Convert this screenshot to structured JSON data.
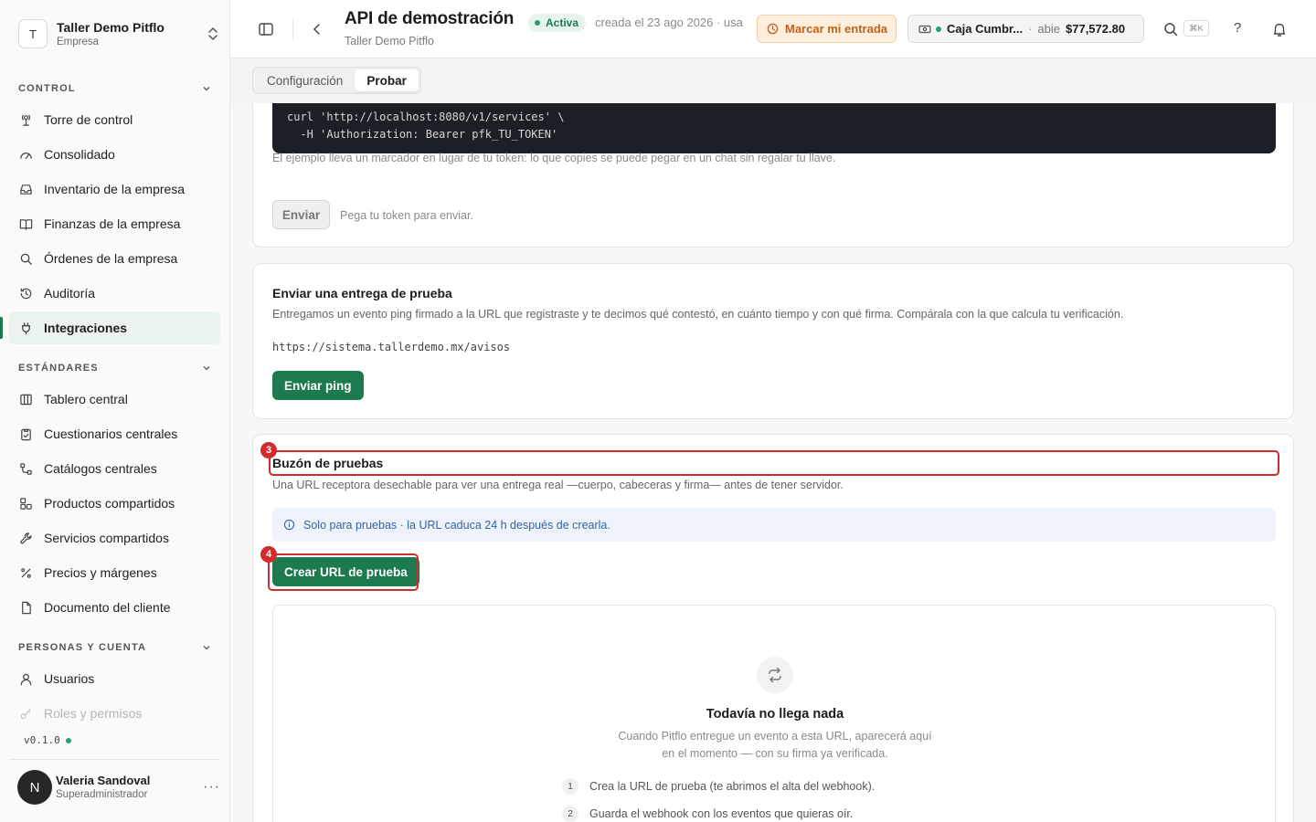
{
  "org": {
    "initial": "T",
    "name": "Taller Demo Pitflo",
    "type": "Empresa"
  },
  "sidebar": {
    "sections": [
      {
        "title": "CONTROL",
        "items": [
          "Torre de control",
          "Consolidado",
          "Inventario de la empresa",
          "Finanzas de la empresa",
          "Órdenes de la empresa",
          "Auditoría",
          "Integraciones"
        ]
      },
      {
        "title": "ESTÁNDARES",
        "items": [
          "Tablero central",
          "Cuestionarios centrales",
          "Catálogos centrales",
          "Productos compartidos",
          "Servicios compartidos",
          "Precios y márgenes",
          "Documento del cliente"
        ]
      },
      {
        "title": "PERSONAS Y CUENTA",
        "items": [
          "Usuarios",
          "Roles y permisos"
        ]
      }
    ],
    "active_item": "Integraciones",
    "version": "v0.1.0"
  },
  "user": {
    "initial": "N",
    "name": "Valeria Sandoval",
    "role": "Superadministrador",
    "more": "···"
  },
  "header": {
    "title": "API de demostración",
    "subtitle": "Taller Demo Pitflo",
    "status": "Activa",
    "created": "creada el 23 ago 2026 · usa",
    "clock_in_label": "Marcar mi entrada",
    "cash_name": "Caja Cumbr...",
    "cash_sep": "·",
    "cash_status": "abie",
    "cash_amount": "$77,572.80",
    "shortcut": "⌘K",
    "help": "?"
  },
  "tabs": [
    "Configuración",
    "Probar"
  ],
  "active_tab": "Probar",
  "request_card": {
    "code_line1": "curl 'http://localhost:8080/v1/services' \\",
    "code_line2": "  -H 'Authorization: Bearer pfk_TU_TOKEN'",
    "hint": "El ejemplo lleva un marcador en lugar de tu token: lo que copies se puede pegar en un chat sin regalar tu llave.",
    "send_label": "Enviar",
    "send_hint": "Pega tu token para enviar."
  },
  "ping_card": {
    "title": "Enviar una entrega de prueba",
    "desc": "Entregamos un evento ping firmado a la URL que registraste y te decimos qué contestó, en cuánto tiempo y con qué firma. Compárala con la que calcula tu verificación.",
    "url": "https://sistema.tallerdemo.mx/avisos",
    "button": "Enviar ping"
  },
  "inbox_card": {
    "title": "Buzón de pruebas",
    "desc": "Una URL receptora desechable para ver una entrega real —cuerpo, cabeceras y firma— antes de tener servidor.",
    "info": "Solo para pruebas · la URL caduca 24 h después de crearla.",
    "button": "Crear URL de prueba",
    "annot_title": "3",
    "annot_button": "4",
    "empty_title": "Todavía no llega nada",
    "empty_desc": "Cuando Pitflo entregue un evento a esta URL, aparecerá aquí en el momento — con su firma ya verificada.",
    "steps": [
      {
        "num": "1",
        "text": "Crea la URL de prueba (te abrimos el alta del webhook)."
      },
      {
        "num": "2",
        "text": "Guarda el webhook con los eventos que quieras oír."
      }
    ]
  },
  "colors": {
    "accent": "#1d7a4f",
    "annotation": "#d12b2b",
    "info": "#3761a8"
  }
}
